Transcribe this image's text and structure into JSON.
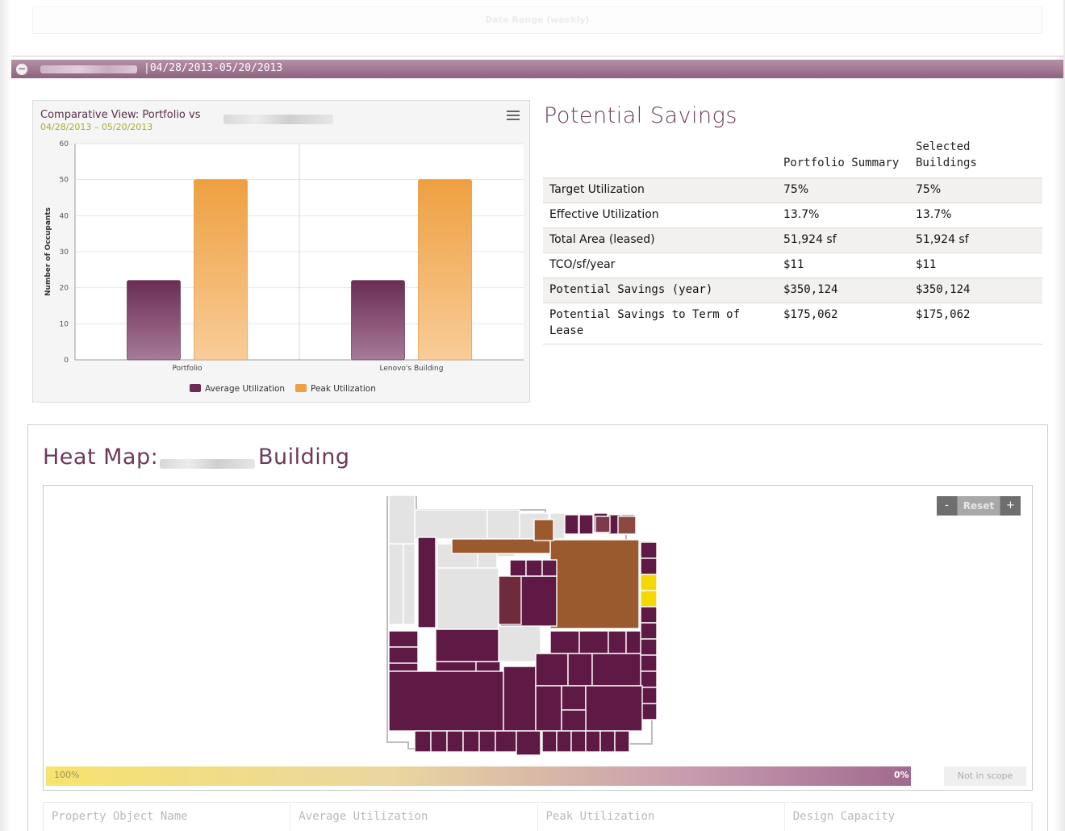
{
  "top": {
    "date_range_label": "Date Range (weekly)"
  },
  "section": {
    "collapse_icon": "minus-circle-icon",
    "dates": "|04/28/2013-05/20/2013"
  },
  "chart": {
    "title": "Comparative View: Portfolio vs",
    "subtitle": "04/28/2013 – 05/20/2013",
    "menu_icon": "hamburger-menu-icon"
  },
  "chart_data": {
    "type": "bar",
    "categories": [
      "Portfolio",
      "Lenovo's Building"
    ],
    "series": [
      {
        "name": "Average Utilization",
        "values": [
          22,
          22
        ],
        "color": "#6b2d55"
      },
      {
        "name": "Peak Utilization",
        "values": [
          50,
          50
        ],
        "color": "#f0a040"
      }
    ],
    "ylabel": "Number of Occupants",
    "ylim": [
      0,
      60
    ],
    "yticks": [
      "0",
      "10",
      "20",
      "30",
      "40",
      "50",
      "60"
    ],
    "legend": "bottom-center",
    "grid": true
  },
  "savings": {
    "title": "Potential Savings",
    "headers": [
      "",
      "Portfolio Summary",
      "Selected Buildings"
    ],
    "rows": [
      {
        "label": "Target Utilization",
        "portfolio": "75%",
        "selected": "75%"
      },
      {
        "label": "Effective Utilization",
        "portfolio": "13.7%",
        "selected": "13.7%"
      },
      {
        "label": "Total Area (leased)",
        "portfolio": "51,924 sf",
        "selected": "51,924 sf"
      },
      {
        "label": "TCO/sf/year",
        "portfolio": "$11",
        "selected": "$11"
      },
      {
        "label": "Potential Savings (year)",
        "portfolio": "$350,124",
        "selected": "$350,124"
      },
      {
        "label": "Potential Savings to Term of Lease",
        "portfolio": "$175,062",
        "selected": "$175,062"
      }
    ]
  },
  "heatmap": {
    "title_prefix": "Heat Map:",
    "title_suffix": "Building",
    "zoom": {
      "minus": "-",
      "reset": "Reset",
      "plus": "+"
    },
    "legend": {
      "max": "100%",
      "min": "0%",
      "not_in_scope": "Not in scope"
    },
    "colors": {
      "high": "#f5d800",
      "mid": "#9a5a2e",
      "low": "#5e1a45",
      "out": "#e3e3e3"
    },
    "columns": [
      "Property Object Name",
      "Average Utilization",
      "Peak Utilization",
      "Design Capacity"
    ]
  }
}
